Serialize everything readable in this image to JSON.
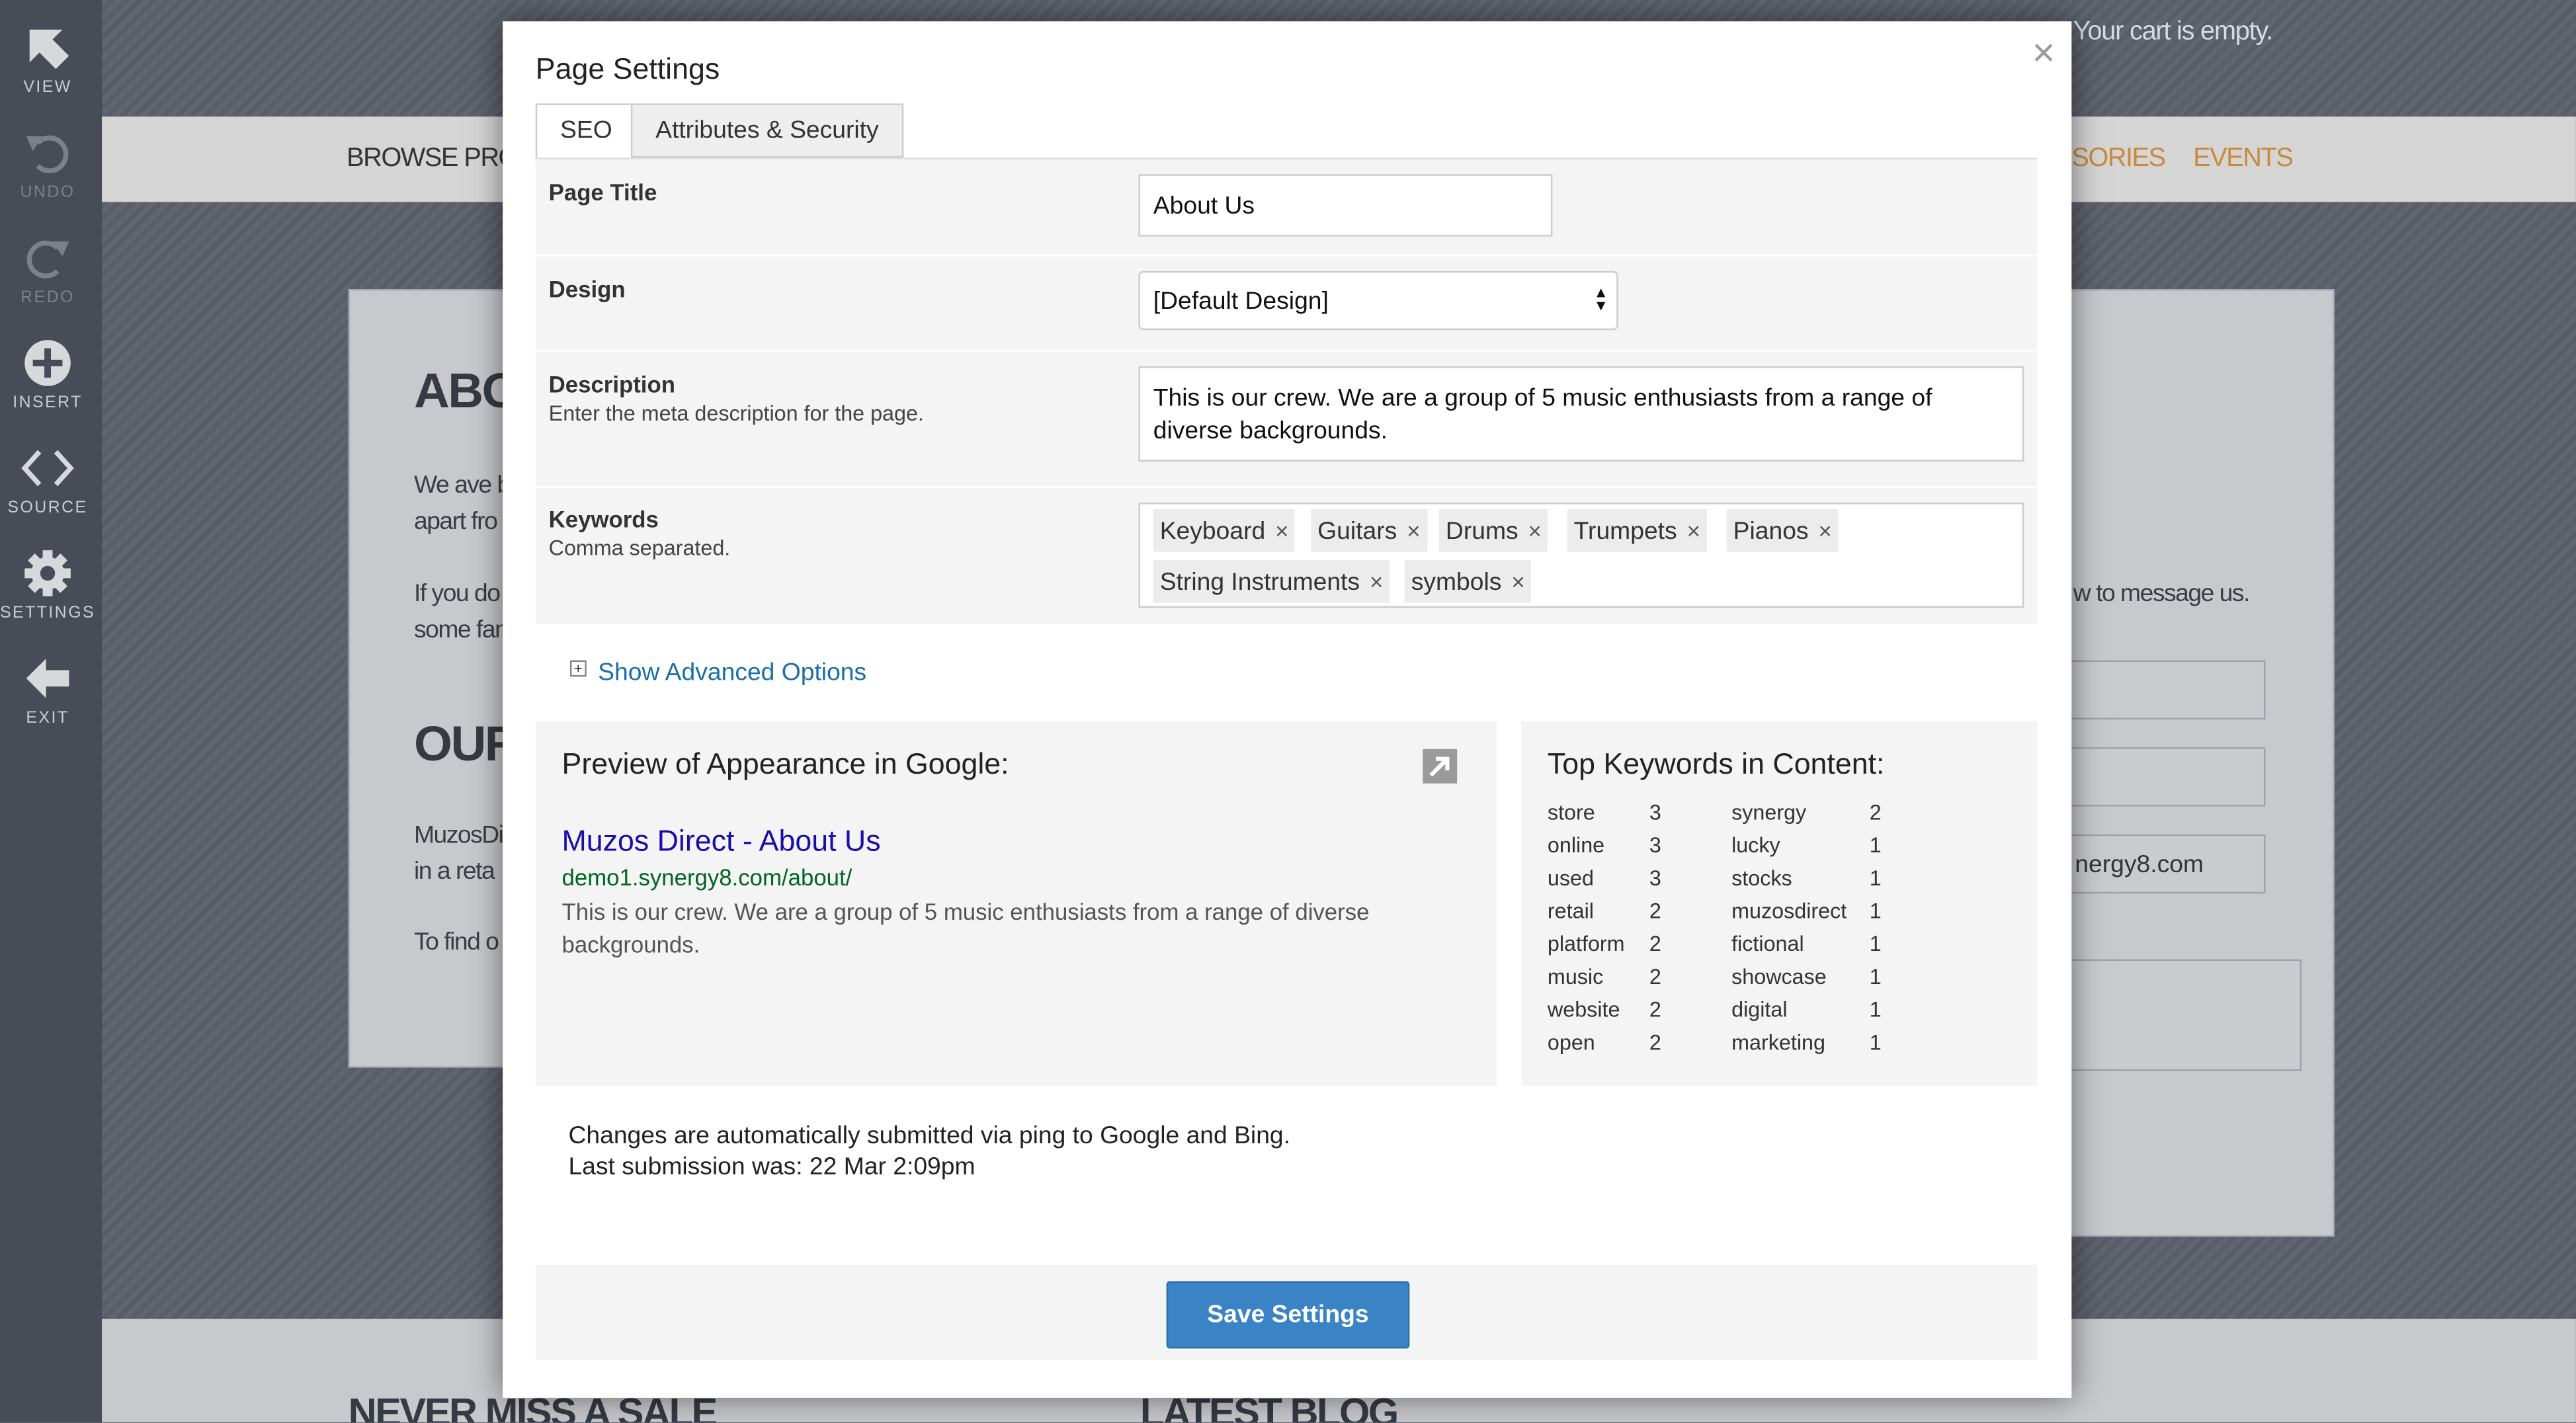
{
  "site": {
    "cart": "Your cart is empty.",
    "nav": [
      "BROWSE PRODU",
      "SORIES",
      "EVENTS"
    ],
    "heading_about": "ABO",
    "heading_our": "OUR",
    "text_lines": [
      "We ave b",
      "apart fro",
      "If you do",
      "some fan",
      "MuzosDir",
      "in a reta",
      "To find o"
    ],
    "side_message": "w to message us.",
    "side_email": "nergy8.com",
    "footer_left": "NEVER MISS A SALE",
    "footer_right": "LATEST BLOG"
  },
  "sidebar": {
    "items": [
      {
        "label": "VIEW",
        "icon": "arrow-up-left-icon"
      },
      {
        "label": "UNDO",
        "icon": "undo-icon"
      },
      {
        "label": "REDO",
        "icon": "redo-icon"
      },
      {
        "label": "INSERT",
        "icon": "plus-circle-icon"
      },
      {
        "label": "SOURCE",
        "icon": "code-icon"
      },
      {
        "label": "SETTINGS",
        "icon": "gear-icon"
      },
      {
        "label": "EXIT",
        "icon": "arrow-left-icon"
      }
    ]
  },
  "modal": {
    "title": "Page Settings",
    "close": "×",
    "tabs": [
      "SEO",
      "Attributes & Security"
    ],
    "page_title": {
      "label": "Page Title",
      "value": "About Us"
    },
    "design": {
      "label": "Design",
      "value": "[Default Design]"
    },
    "description": {
      "label": "Description",
      "hint": "Enter the meta description for the page.",
      "value": "This is our crew. We are a group of 5 music enthusiasts from a range of diverse backgrounds."
    },
    "keywords": {
      "label": "Keywords",
      "hint": "Comma separated.",
      "tags": [
        "Keyboard",
        "Guitars",
        "Drums",
        "Trumpets",
        "Pianos",
        "String Instruments",
        "symbols"
      ],
      "remove": "×"
    },
    "advanced": {
      "icon": "+",
      "label": "Show Advanced Options"
    },
    "preview": {
      "heading": "Preview of Appearance in Google:",
      "link": "Muzos Direct - About Us",
      "url": "demo1.synergy8.com/about/",
      "snippet_1": "This is our crew. We are a group of 5 music enthusiasts from a range of diverse",
      "snippet_2": "backgrounds."
    },
    "top_keywords": {
      "heading": "Top Keywords in Content:",
      "left": [
        [
          "store",
          "3"
        ],
        [
          "online",
          "3"
        ],
        [
          "used",
          "3"
        ],
        [
          "retail",
          "2"
        ],
        [
          "platform",
          "2"
        ],
        [
          "music",
          "2"
        ],
        [
          "website",
          "2"
        ],
        [
          "open",
          "2"
        ]
      ],
      "right": [
        [
          "synergy",
          "2"
        ],
        [
          "lucky",
          "1"
        ],
        [
          "stocks",
          "1"
        ],
        [
          "muzosdirect",
          "1"
        ],
        [
          "fictional",
          "1"
        ],
        [
          "showcase",
          "1"
        ],
        [
          "digital",
          "1"
        ],
        [
          "marketing",
          "1"
        ]
      ]
    },
    "notice_1": "Changes are automatically submitted via ping to Google and Bing.",
    "notice_2": "Last submission was: 22 Mar 2:09pm",
    "save": "Save Settings"
  }
}
